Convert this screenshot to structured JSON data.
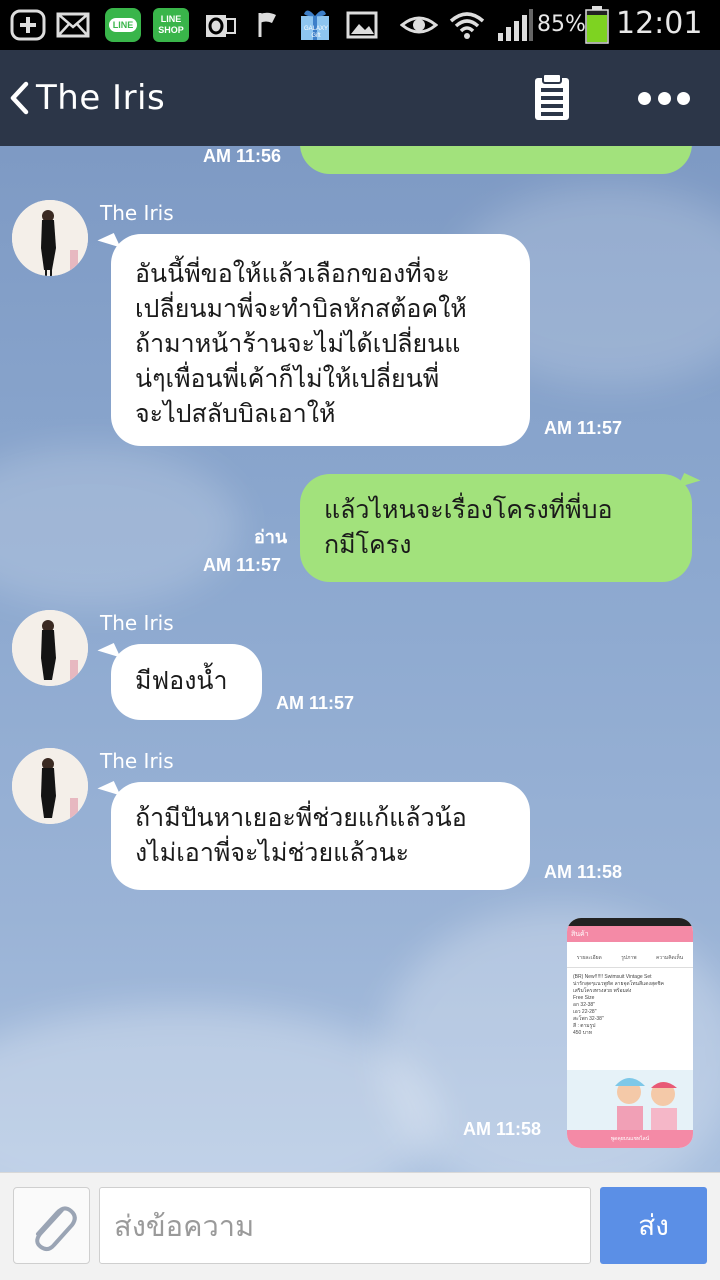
{
  "status_bar": {
    "battery_percent": "85%",
    "time": "12:01",
    "icons": [
      "add-icon",
      "mail-icon",
      "line-app-icon",
      "line-shop-icon",
      "outlook-icon",
      "flag-icon",
      "gift-icon",
      "gallery-icon",
      "eye-icon",
      "wifi-icon",
      "signal-icon",
      "battery-icon"
    ],
    "line_icon_label": "LINE",
    "line_shop_label_top": "LINE",
    "line_shop_label_bottom": "SHOP",
    "gift_label": "GALAXY Gift",
    "colors": {
      "line_green": "#39b54a",
      "battery_green": "#7ed321"
    }
  },
  "header": {
    "title": "The Iris",
    "background": "#2c3648"
  },
  "chat": {
    "messages": [
      {
        "direction": "out",
        "time": "AM 11:56",
        "text": "",
        "partial": true
      },
      {
        "direction": "in",
        "sender": "The Iris",
        "time": "AM 11:57",
        "lines": [
          "อันนี้พี่ขอให้แล้วเลือกของที่จะ",
          "เปลี่ยนมาพี่จะทำบิลหักสต้อคให้",
          "ถ้ามาหน้าร้านจะไม่ได้เปลี่ยนแ",
          "น่ๆเพื่อนพี่เค้าก็ไม่ให้เปลี่ยนพี่",
          "จะไปสลับบิลเอาให้"
        ]
      },
      {
        "direction": "out",
        "read_label": "อ่าน",
        "time": "AM 11:57",
        "lines": [
          "แล้วไหนจะเรื่องโครงที่พี่บอ",
          "กมีโครง"
        ]
      },
      {
        "direction": "in",
        "sender": "The Iris",
        "time": "AM 11:57",
        "lines": [
          "มีฟองน้ำ"
        ]
      },
      {
        "direction": "in",
        "sender": "The Iris",
        "time": "AM 11:58",
        "lines": [
          "ถ้ามีปันหาเยอะพี่ช่วยแก้แล้วน้อ",
          "งไม่เอาพี่จะไม่ช่วยแล้วนะ"
        ]
      },
      {
        "direction": "out",
        "type": "image",
        "time": "AM 11:58",
        "image_title": "สินค้า",
        "image_tabs": [
          "รายละเอียด",
          "รูปภาพ",
          "ความคิดเห็น"
        ],
        "image_desc_lines": [
          "(BR) New!!!!!! Swimsuit Vintage Set",
          "น่ารักสุดๆแนวพูหัด ลายจุดโทนสีแดงสุดชิค",
          "เสริมโครงทรงสวย พร้อมส่ง",
          "Free Size",
          "อก 32-38\"",
          "เอว 22-28\"",
          "สะโพก 32-38\"",
          "สี : ตามรูป",
          "450 บาท"
        ],
        "image_footer": "พูดคุยบนแชทไลน์"
      }
    ]
  },
  "input_bar": {
    "placeholder": "ส่งข้อความ",
    "value": "",
    "send_label": "ส่ง"
  },
  "colors": {
    "in_bubble": "#ffffff",
    "out_bubble": "#a2e27c",
    "send_button": "#5b8fe6"
  }
}
